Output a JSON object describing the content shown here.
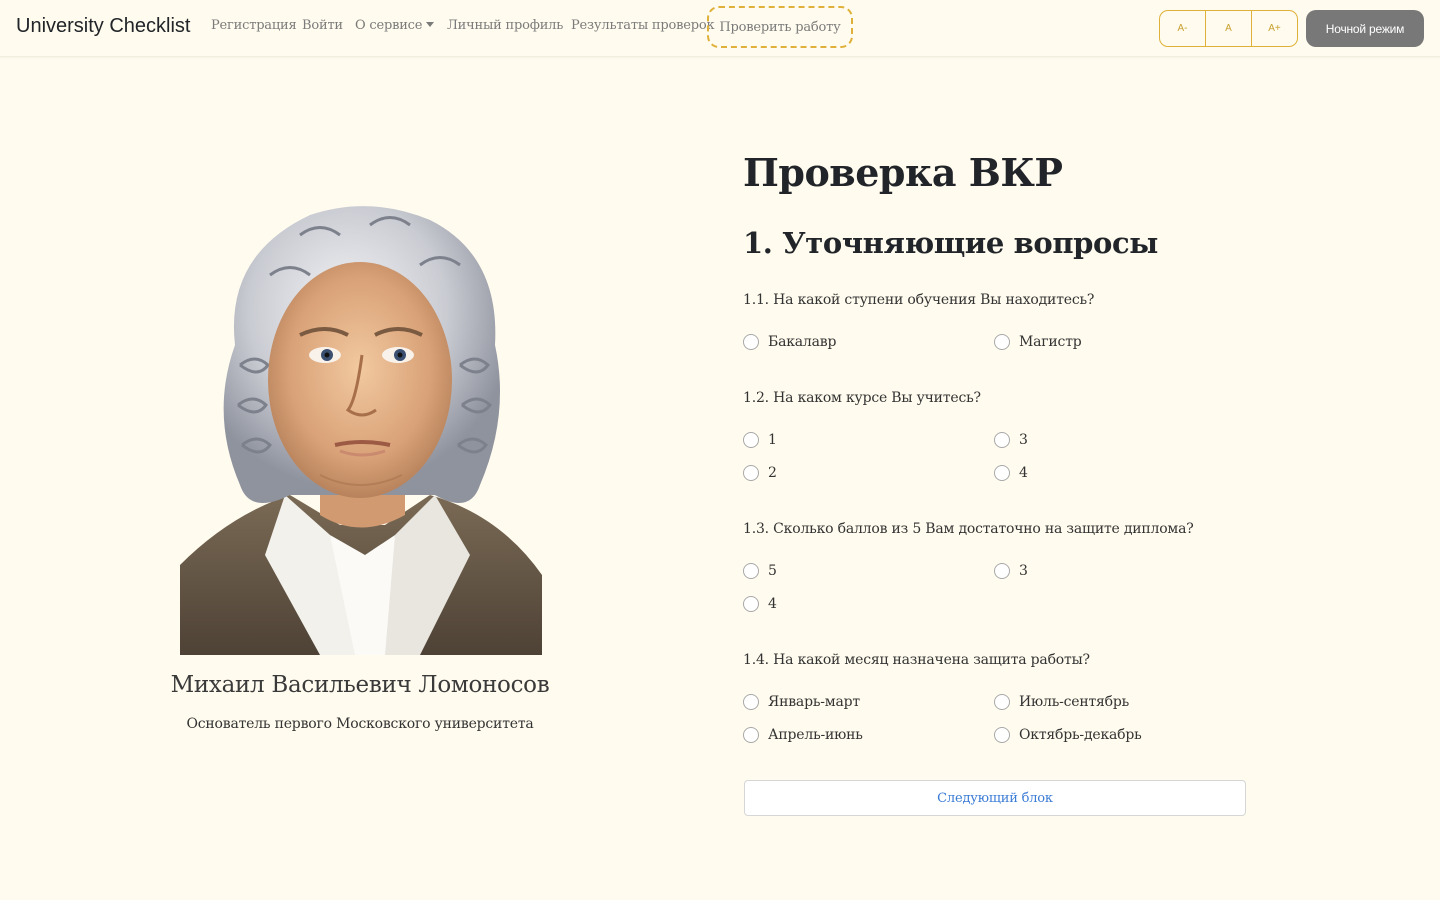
{
  "navbar": {
    "brand": "University Checklist",
    "links": {
      "register": "Регистрация",
      "login": "Войти",
      "about": "О сервисе",
      "profile": "Личный профиль",
      "results": "Результаты проверок",
      "check": "Проверить работу"
    },
    "font_controls": {
      "decrease": "A-",
      "normal": "A",
      "increase": "A+"
    },
    "night_mode": "Ночной режим"
  },
  "person": {
    "name": "Михаил Васильевич Ломоносов",
    "caption": "Основатель первого Московского университета"
  },
  "main": {
    "title": "Проверка ВКР",
    "section_title": "1. Уточняющие вопросы",
    "questions": [
      {
        "text": "1.1. На какой ступени обучения Вы находитесь?",
        "options": [
          "Бакалавр",
          "Магистр"
        ]
      },
      {
        "text": "1.2. На каком курсе Вы учитесь?",
        "options": [
          "1",
          "3",
          "2",
          "4"
        ]
      },
      {
        "text": "1.3. Сколько баллов из 5 Вам достаточно на защите диплома?",
        "options": [
          "5",
          "3",
          "4"
        ]
      },
      {
        "text": "1.4. На какой месяц назначена защита работы?",
        "options": [
          "Январь-март",
          "Июль-сентябрь",
          "Апрель-июнь",
          "Октябрь-декабрь"
        ]
      }
    ],
    "next_button": "Следующий блок"
  },
  "colors": {
    "background": "#fffbee",
    "accent_outline": "#e0b13a",
    "night_button": "#787878",
    "link_blue": "#3a7bd5"
  },
  "icons": {
    "dropdown": "caret-down-icon",
    "radio": "radio-unchecked-icon"
  }
}
